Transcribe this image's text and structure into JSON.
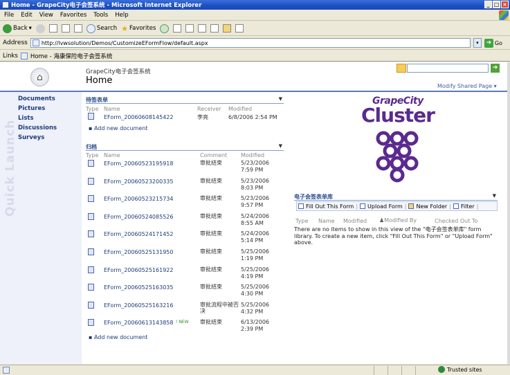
{
  "window": {
    "title": "Home - GrapeCity电子会签系统 - Microsoft Internet Explorer"
  },
  "menu": [
    "File",
    "Edit",
    "View",
    "Favorites",
    "Tools",
    "Help"
  ],
  "toolbar": {
    "back": "Back",
    "search": "Search",
    "favorites": "Favorites"
  },
  "address": {
    "label": "Address",
    "url": "http://lvwsolution/Demos/CustomizeEFormFlow/default.aspx",
    "go": "Go"
  },
  "links": {
    "label": "Links",
    "item": "Home - 海康保险电子会签系统"
  },
  "header": {
    "site_title": "GrapeCity电子会签系统",
    "page_title": "Home",
    "modify": "Modify Shared Page ▾"
  },
  "nav": {
    "watermark": "Quick Launch",
    "items": [
      "Documents",
      "Pictures",
      "Lists",
      "Discussions",
      "Surveys"
    ]
  },
  "pending": {
    "title": "待签表单",
    "cols": [
      "Type",
      "Name",
      "Receiver",
      "Modified"
    ],
    "rows": [
      {
        "name": "EForm_20060608145422",
        "receiver": "李亮",
        "modified": "6/8/2006 2:54 PM"
      }
    ],
    "add": "Add new document"
  },
  "archive": {
    "title": "归档",
    "cols": [
      "Type",
      "Name",
      "Comment",
      "Modified"
    ],
    "rows": [
      {
        "name": "EForm_20060523195918",
        "comment": "审批结束",
        "date": "5/23/2006",
        "time": "7:59 PM"
      },
      {
        "name": "EForm_20060523200335",
        "comment": "审批结束",
        "date": "5/23/2006",
        "time": "8:03 PM"
      },
      {
        "name": "EForm_20060523215734",
        "comment": "审批结束",
        "date": "5/23/2006",
        "time": "9:57 PM"
      },
      {
        "name": "EForm_20060524085526",
        "comment": "审批结束",
        "date": "5/24/2006",
        "time": "8:55 AM"
      },
      {
        "name": "EForm_20060524171452",
        "comment": "审批结束",
        "date": "5/24/2006",
        "time": "5:14 PM"
      },
      {
        "name": "EForm_20060525131950",
        "comment": "审批结束",
        "date": "5/25/2006",
        "time": "1:19 PM"
      },
      {
        "name": "EForm_20060525161922",
        "comment": "审批结束",
        "date": "5/25/2006",
        "time": "4:19 PM"
      },
      {
        "name": "EForm_20060525163035",
        "comment": "审批结束",
        "date": "5/25/2006",
        "time": "4:30 PM"
      },
      {
        "name": "EForm_20060525163216",
        "comment": "审批流程中被否决",
        "date": "5/25/2006",
        "time": "4:32 PM"
      },
      {
        "name": "EForm_20060613143858",
        "comment": "审批结束",
        "date": "6/13/2006",
        "time": "2:39 PM",
        "badge": "! NEW"
      }
    ],
    "add": "Add new document"
  },
  "logo": {
    "top": "GrapeCity",
    "main": "Cluster",
    "color": "#5a2a8f"
  },
  "library": {
    "title": "电子会签表单库",
    "toolbar": [
      "Fill Out This Form",
      "Upload Form",
      "New Folder",
      "Filter"
    ],
    "cols": [
      "Type",
      "Name",
      "Modified",
      "Modified By",
      "Checked Out To"
    ],
    "empty": "There are no items to show in this view of the \"电子会签表单库\" form library. To create a new item, click \"Fill Out This Form\" or \"Upload Form\" above."
  },
  "status": {
    "zone": "Trusted sites"
  }
}
